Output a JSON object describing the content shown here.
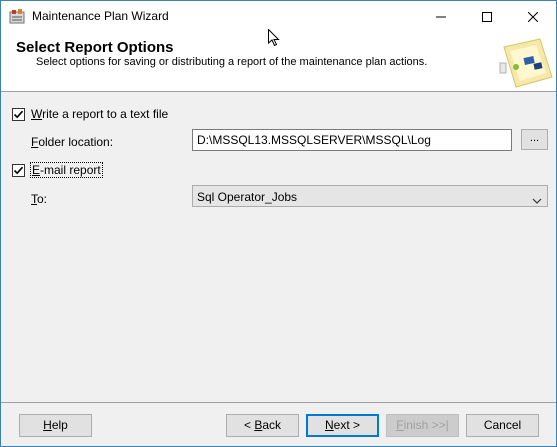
{
  "window": {
    "title": "Maintenance Plan Wizard"
  },
  "header": {
    "title": "Select Report Options",
    "subtitle": "Select options for saving or distributing a report of the maintenance plan actions."
  },
  "text_report": {
    "checkbox_label_accel": "W",
    "checkbox_label_rest": "rite a report to a text file",
    "checked": true,
    "folder_label_accel": "F",
    "folder_label_rest": "older location:",
    "folder_value": "D:\\MSSQL13.MSSQLSERVER\\MSSQL\\Log",
    "browse_label": "..."
  },
  "email_report": {
    "checkbox_label_accel": "E",
    "checkbox_label_rest": "-mail report",
    "checked": true,
    "to_label_accel": "T",
    "to_label_rest": "o:",
    "to_value": "Sql Operator_Jobs"
  },
  "footer": {
    "help_accel": "H",
    "help_rest": "elp",
    "back_prefix": "< ",
    "back_accel": "B",
    "back_rest": "ack",
    "next_accel": "N",
    "next_rest": "ext >",
    "finish_accel": "F",
    "finish_rest": "inish >>|",
    "cancel_label": "Cancel"
  },
  "colors": {
    "window_border": "#3c7fb1",
    "default_button_border": "#0078d7",
    "dialog_background": "#f0f0f0"
  }
}
